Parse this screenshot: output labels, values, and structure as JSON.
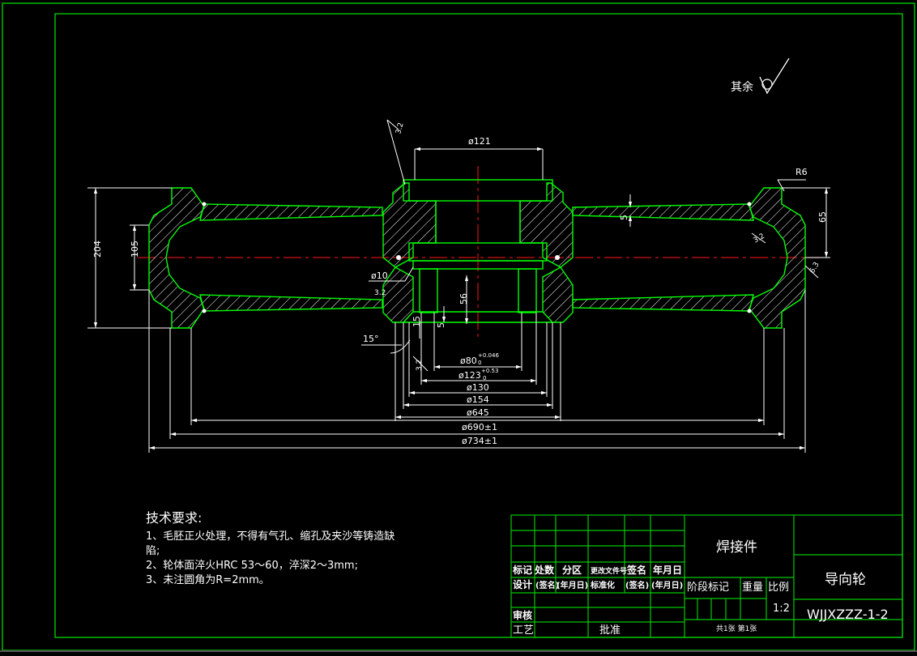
{
  "colors": {
    "background": "#000000",
    "frame": "#00c800",
    "part": "#00ff00",
    "dimension": "#ffffff",
    "centerline": "#d01010",
    "hatch": "#ffffff",
    "text": "#ffffff"
  },
  "roughness": {
    "general_label": "其余",
    "value_32": "3.2",
    "value_63": "6.3"
  },
  "dimensions": {
    "d121": "ø121",
    "r6": "R6",
    "h204": "204",
    "h105": "105",
    "h65": "65",
    "v5_top": "5",
    "d10": "ø10",
    "v56": "56",
    "v15": "15",
    "v5_bottom": "5",
    "angle15": "15°",
    "d80": "ø80",
    "d80_tol_upper": "+0.046",
    "d80_tol_lower": "0",
    "d123": "ø123",
    "d123_tol_upper": "+0.53",
    "d123_tol_lower": "0",
    "d130": "ø130",
    "d154": "ø154",
    "d645": "ø645",
    "d690": "ø690±1",
    "d734": "ø734±1"
  },
  "tech_requirements": {
    "title": "技术要求:",
    "line1": "1、毛胚正火处理，不得有气孔、缩孔及夹沙等铸造缺",
    "line1b": "陷;",
    "line2": "2、轮体面淬火HRC 53～60，淬深2～3mm;",
    "line3": "3、未注圆角为R=2mm。"
  },
  "title_block": {
    "material": "焊接件",
    "part_name": "导向轮",
    "drawing_no": "WJJXZZZ-1-2",
    "header_mark": "标记",
    "header_count": "处数",
    "header_zone": "分区",
    "header_docno": "更改文件号",
    "header_sign": "签名",
    "header_date": "年月日",
    "design": "设计",
    "sign1": "(签名)",
    "date1": "(年月日)",
    "standard": "标准化",
    "sign2": "(签名)",
    "date2": "(年月日)",
    "stage_mark": "阶段标记",
    "weight": "重量",
    "scale": "比例",
    "scale_value": "1:2",
    "review": "审核",
    "process": "工艺",
    "approve": "批准",
    "sheets": "共1张  第1张"
  }
}
